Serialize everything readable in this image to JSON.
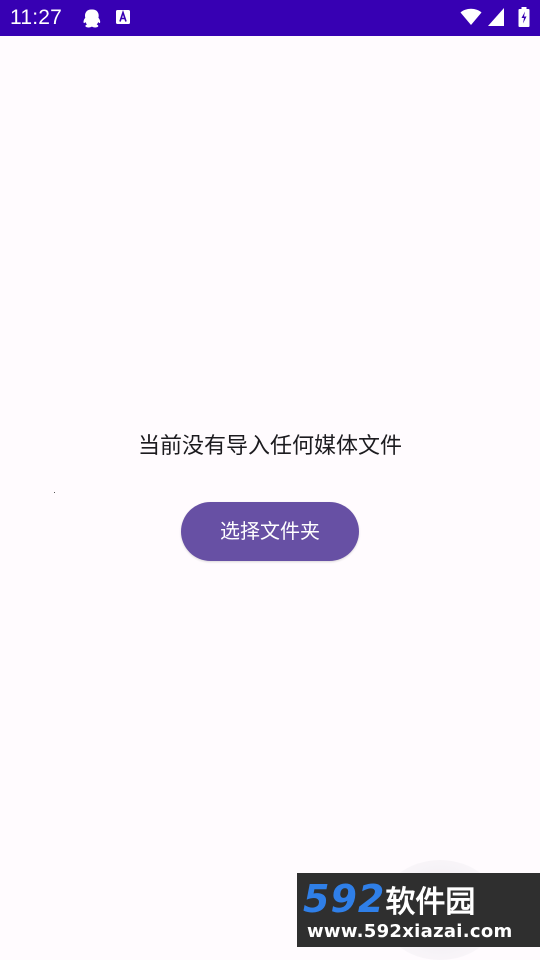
{
  "status_bar": {
    "time": "11:27",
    "left_icons": [
      "qq-icon",
      "a-icon"
    ],
    "right_icons": [
      "wifi-icon",
      "signal-icon",
      "battery-charging-icon"
    ],
    "background_color": "#3700b3"
  },
  "main": {
    "empty_message": "当前没有导入任何媒体文件",
    "select_folder_label": "选择文件夹",
    "button_color": "#6750a4"
  },
  "watermark": {
    "brand_number": "592",
    "brand_text": "软件园",
    "url": "www.592xiazai.com"
  }
}
